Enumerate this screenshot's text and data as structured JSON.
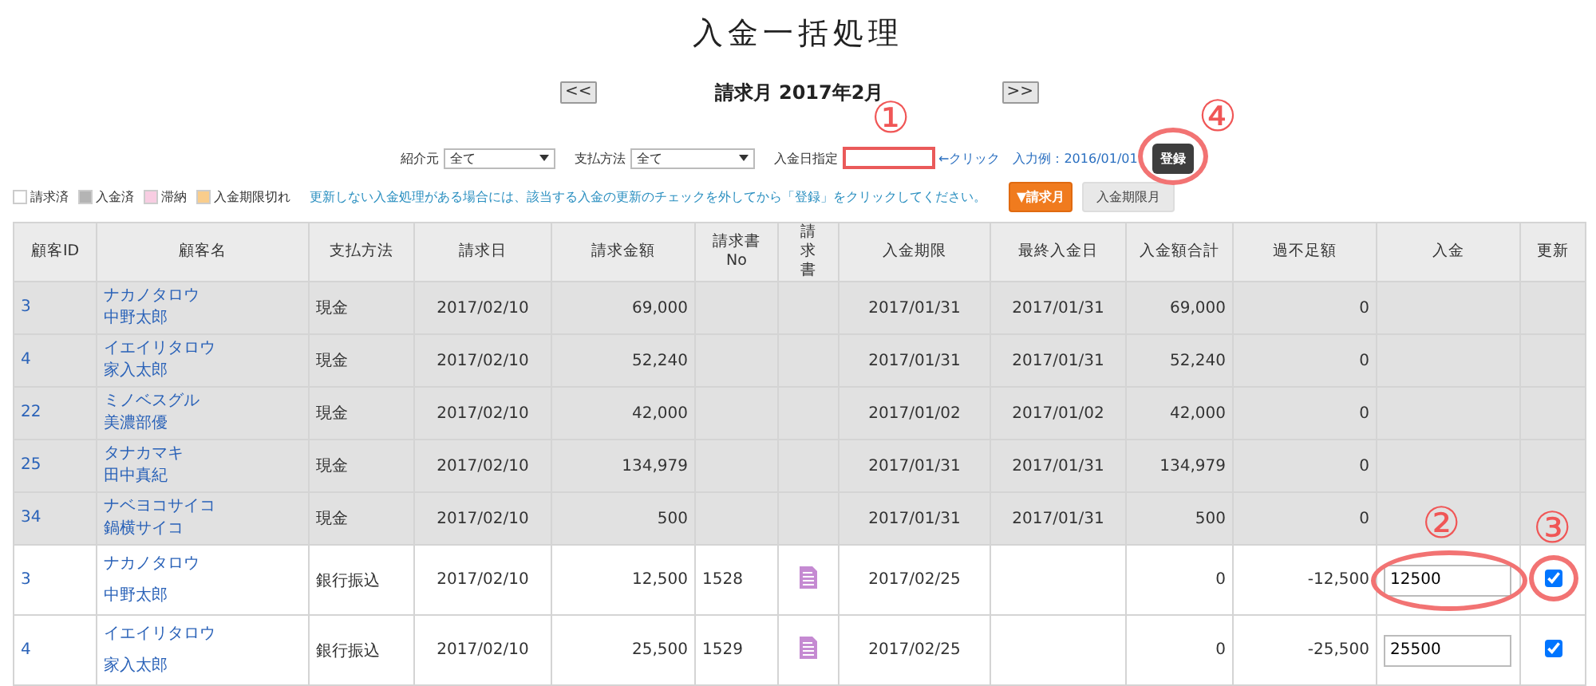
{
  "title": "入金一括処理",
  "month_nav": {
    "prev": "<<",
    "label": "請求月 2017年2月",
    "next": ">>"
  },
  "filters": {
    "referrer": {
      "label": "紹介元",
      "value": "全て"
    },
    "payment_method": {
      "label": "支払方法",
      "value": "全て"
    },
    "payment_date": {
      "label": "入金日指定",
      "marker": "①"
    },
    "click_hint": "←クリック",
    "example": "入力例：2016/01/01",
    "register_button": {
      "label": "登録",
      "marker": "④"
    }
  },
  "legend": [
    {
      "label": "請求済",
      "color": "#ffffff"
    },
    {
      "label": "入金済",
      "color": "#b4b4b4"
    },
    {
      "label": "滞納",
      "color": "#f8cde2"
    },
    {
      "label": "入金期限切れ",
      "color": "#f9cd8c"
    }
  ],
  "notice": "更新しない入金処理がある場合には、該当する入金の更新のチェックを外してから「登録」をクリックしてください。",
  "sort_tabs": [
    {
      "label": "▼請求月",
      "selected": true
    },
    {
      "label": "入金期限月",
      "selected": false
    }
  ],
  "table": {
    "columns": [
      "顧客ID",
      "顧客名",
      "支払方法",
      "請求日",
      "請求金額",
      "請求書\nNo",
      "請求書",
      "入金期限",
      "最終入金日",
      "入金額合計",
      "過不足額",
      "入金",
      "更新"
    ],
    "rows": [
      {
        "kind": "paid",
        "id": "3",
        "kana": "ナカノタロウ",
        "name": "中野太郎",
        "method": "現金",
        "billing_date": "2017/02/10",
        "amount": "69,000",
        "due": "2017/01/31",
        "last_paid": "2017/01/31",
        "paid_total": "69,000",
        "balance": "0"
      },
      {
        "kind": "paid",
        "id": "4",
        "kana": "イエイリタロウ",
        "name": "家入太郎",
        "method": "現金",
        "billing_date": "2017/02/10",
        "amount": "52,240",
        "due": "2017/01/31",
        "last_paid": "2017/01/31",
        "paid_total": "52,240",
        "balance": "0"
      },
      {
        "kind": "paid",
        "id": "22",
        "kana": "ミノベスグル",
        "name": "美濃部優",
        "method": "現金",
        "billing_date": "2017/02/10",
        "amount": "42,000",
        "due": "2017/01/02",
        "last_paid": "2017/01/02",
        "paid_total": "42,000",
        "balance": "0"
      },
      {
        "kind": "paid",
        "id": "25",
        "kana": "タナカマキ",
        "name": "田中真紀",
        "method": "現金",
        "billing_date": "2017/02/10",
        "amount": "134,979",
        "due": "2017/01/31",
        "last_paid": "2017/01/31",
        "paid_total": "134,979",
        "balance": "0"
      },
      {
        "kind": "paid",
        "id": "34",
        "kana": "ナベヨコサイコ",
        "name": "鍋横サイコ",
        "method": "現金",
        "billing_date": "2017/02/10",
        "amount": "500",
        "due": "2017/01/31",
        "last_paid": "2017/01/31",
        "paid_total": "500",
        "balance": "0"
      },
      {
        "kind": "billed",
        "id": "3",
        "kana": "ナカノタロウ",
        "name": "中野太郎",
        "method": "銀行振込",
        "billing_date": "2017/02/10",
        "amount": "12,500",
        "invoice_no": "1528",
        "due": "2017/02/25",
        "paid_total": "0",
        "balance": "-12,500",
        "payment": "12500",
        "payment_marker": "②",
        "update": true,
        "update_marker": "③"
      },
      {
        "kind": "billed",
        "id": "4",
        "kana": "イエイリタロウ",
        "name": "家入太郎",
        "method": "銀行振込",
        "billing_date": "2017/02/10",
        "amount": "25,500",
        "invoice_no": "1529",
        "due": "2017/02/25",
        "paid_total": "0",
        "balance": "-25,500",
        "payment": "25500",
        "update": true
      }
    ]
  }
}
